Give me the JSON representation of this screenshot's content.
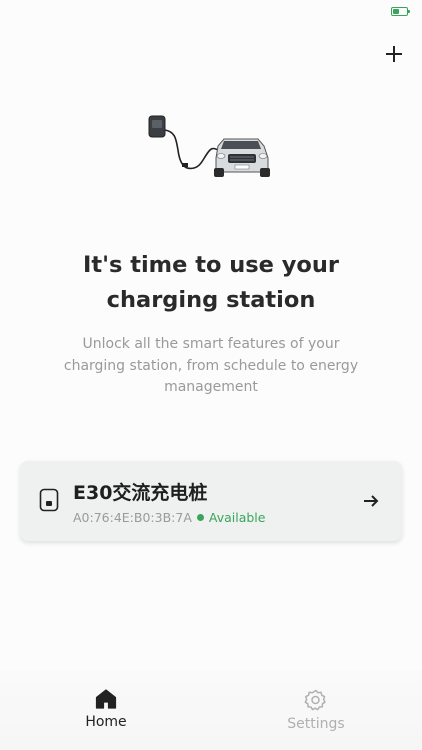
{
  "status_bar": {
    "battery_icon": "battery-charging-icon",
    "battery_level": 0.45,
    "accent": "#3aa55a"
  },
  "header": {
    "add_icon": "plus-icon"
  },
  "hero": {
    "illustration": "charger-and-car-illustration"
  },
  "headline": {
    "line1": "It's time to use your",
    "line2": "charging station"
  },
  "subtext": "Unlock all the smart features of your charging station, from schedule to energy management",
  "device": {
    "name": "E30交流充电桩",
    "mac": "A0:76:4E:B0:3B:7A",
    "status": "Available",
    "status_color": "#3aa55a",
    "icon": "charger-device-icon",
    "action_icon": "arrow-right-icon"
  },
  "tabs": [
    {
      "label": "Home",
      "icon": "home-icon",
      "active": true
    },
    {
      "label": "Settings",
      "icon": "gear-icon",
      "active": false
    }
  ]
}
